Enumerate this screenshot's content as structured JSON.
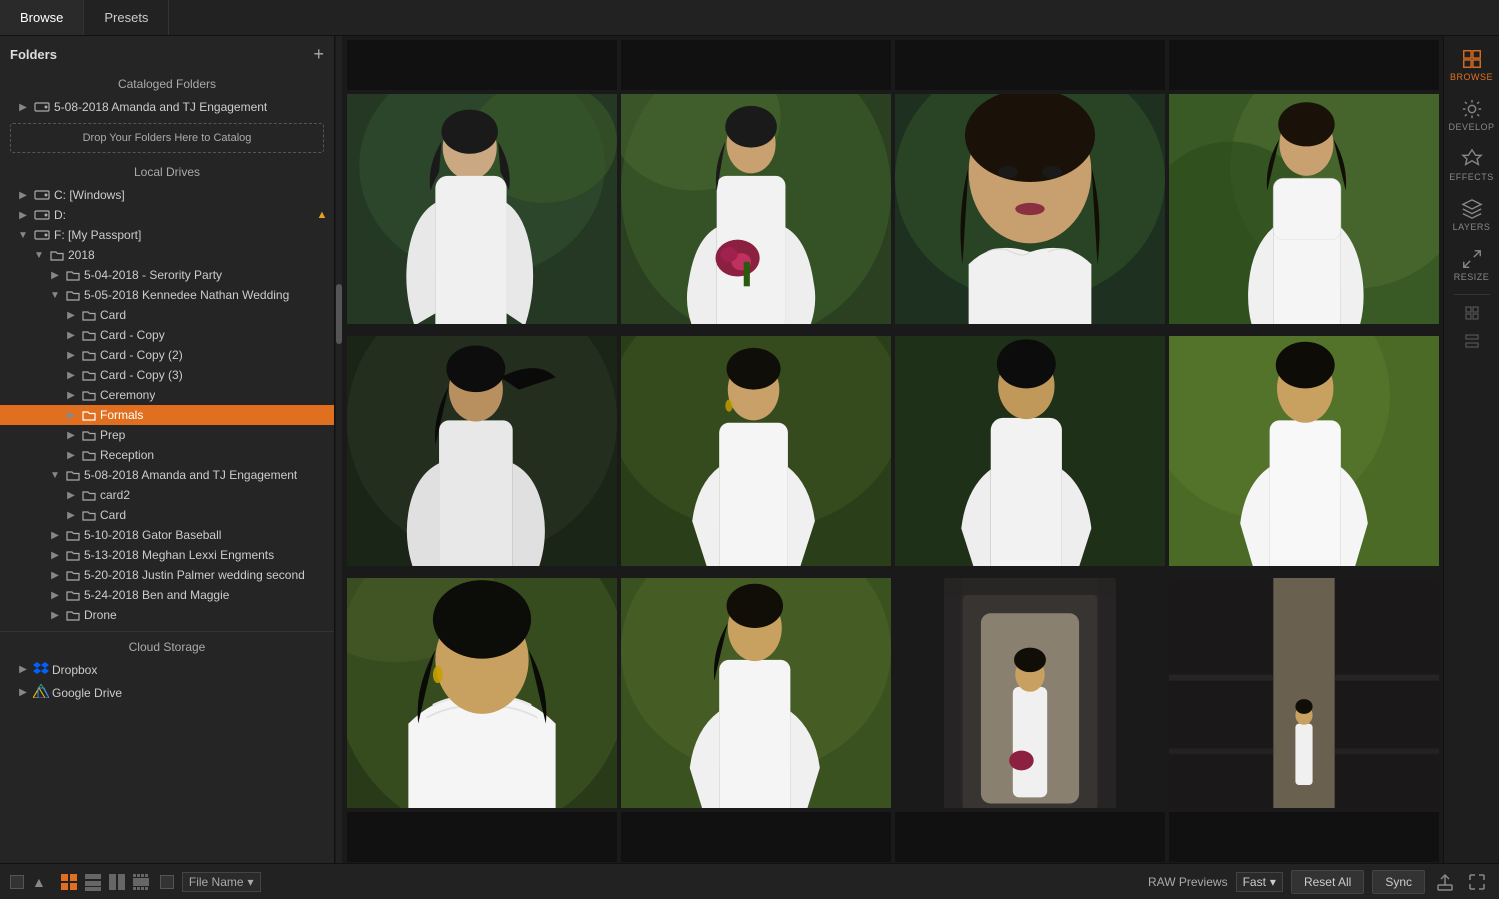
{
  "topBar": {
    "tabs": [
      {
        "id": "browse",
        "label": "Browse",
        "active": true
      },
      {
        "id": "presets",
        "label": "Presets",
        "active": false
      }
    ]
  },
  "sidebar": {
    "title": "Folders",
    "addBtn": "+",
    "catalogedFolders": {
      "title": "Cataloged Folders",
      "items": [
        {
          "label": "5-08-2018 Amanda and TJ Engagement",
          "indent": 1,
          "expanded": false
        }
      ]
    },
    "dropZone": {
      "text": "Drop Your Folders Here to Catalog"
    },
    "localDrives": {
      "title": "Local Drives",
      "items": [
        {
          "label": "C: [Windows]",
          "indent": 1,
          "type": "drive",
          "expanded": false
        },
        {
          "label": "D:",
          "indent": 1,
          "type": "drive",
          "eject": false,
          "expanded": false
        },
        {
          "label": "F: [My Passport]",
          "indent": 1,
          "type": "drive",
          "eject": true,
          "expanded": true,
          "children": [
            {
              "label": "2018",
              "indent": 2,
              "expanded": true,
              "children": [
                {
                  "label": "5-04-2018 - Serority Party",
                  "indent": 3,
                  "expanded": false
                },
                {
                  "label": "5-05-2018 Kennedee Nathan Wedding",
                  "indent": 3,
                  "expanded": true,
                  "children": [
                    {
                      "label": "Card",
                      "indent": 4,
                      "expanded": false
                    },
                    {
                      "label": "Card - Copy",
                      "indent": 4,
                      "expanded": false
                    },
                    {
                      "label": "Card - Copy (2)",
                      "indent": 4,
                      "expanded": false
                    },
                    {
                      "label": "Card - Copy (3)",
                      "indent": 4,
                      "expanded": false
                    },
                    {
                      "label": "Ceremony",
                      "indent": 4,
                      "expanded": false
                    },
                    {
                      "label": "Formals",
                      "indent": 4,
                      "expanded": false,
                      "selected": true
                    },
                    {
                      "label": "Prep",
                      "indent": 4,
                      "expanded": false
                    },
                    {
                      "label": "Reception",
                      "indent": 4,
                      "expanded": false
                    }
                  ]
                },
                {
                  "label": "5-08-2018 Amanda and TJ Engagement",
                  "indent": 3,
                  "expanded": true,
                  "children": [
                    {
                      "label": "card2",
                      "indent": 4,
                      "expanded": false
                    },
                    {
                      "label": "Card",
                      "indent": 4,
                      "expanded": false
                    }
                  ]
                },
                {
                  "label": "5-10-2018 Gator Baseball",
                  "indent": 3,
                  "expanded": false
                },
                {
                  "label": "5-13-2018 Meghan Lexxi Engments",
                  "indent": 3,
                  "expanded": false
                },
                {
                  "label": "5-20-2018 Justin Palmer wedding second",
                  "indent": 3,
                  "expanded": false
                },
                {
                  "label": "5-24-2018 Ben and Maggie",
                  "indent": 3,
                  "expanded": false
                },
                {
                  "label": "Drone",
                  "indent": 3,
                  "expanded": false
                }
              ]
            }
          ]
        }
      ]
    },
    "cloudStorage": {
      "title": "Cloud Storage",
      "items": [
        {
          "label": "Dropbox",
          "type": "dropbox"
        },
        {
          "label": "Google Drive",
          "type": "gdrive"
        }
      ]
    }
  },
  "rightIcons": [
    {
      "id": "browse",
      "label": "BROWSE",
      "active": true
    },
    {
      "id": "develop",
      "label": "DEVELOP",
      "active": false
    },
    {
      "id": "effects",
      "label": "EFFECTS",
      "active": false
    },
    {
      "id": "layers",
      "label": "LAYERS",
      "active": false
    },
    {
      "id": "resize",
      "label": "RESIZE",
      "active": false
    }
  ],
  "bottomBar": {
    "fileName": "File Name",
    "rawLabel": "RAW Previews",
    "rawValue": "Fast",
    "resetAll": "Reset All",
    "sync": "Sync"
  },
  "photos": {
    "rows": [
      {
        "cells": 4,
        "row": 1
      },
      {
        "cells": 4,
        "row": 2
      },
      {
        "cells": 4,
        "row": 3
      }
    ]
  }
}
